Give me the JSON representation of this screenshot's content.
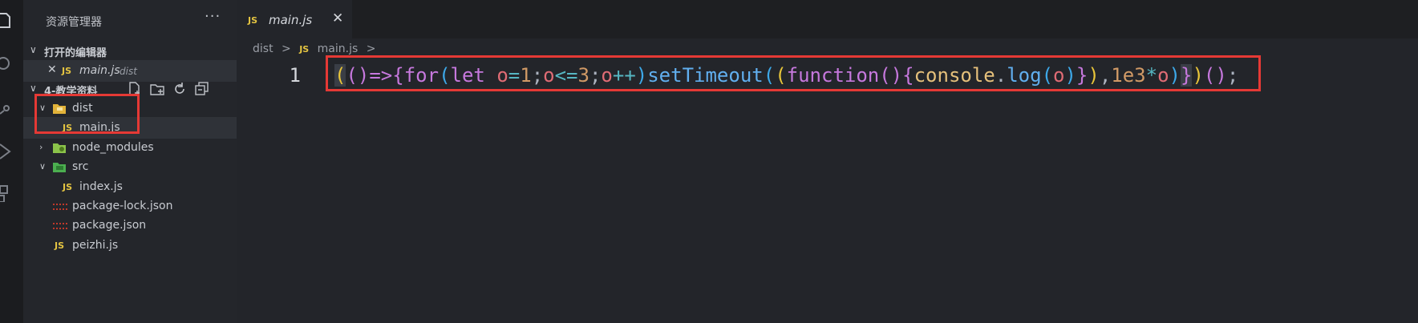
{
  "sidebar": {
    "title": "资源管理器",
    "more": "···",
    "open_editors": {
      "label": "打开的编辑器",
      "items": [
        {
          "close": "✕",
          "badge": "JS",
          "name": "main.js",
          "folder": "dist"
        }
      ]
    },
    "project": {
      "label": "4-教学资料",
      "items": [
        {
          "name": "dist",
          "type": "folder",
          "expanded": true
        },
        {
          "name": "main.js",
          "type": "js"
        },
        {
          "name": "node_modules",
          "type": "folder",
          "expanded": false
        },
        {
          "name": "src",
          "type": "folder",
          "expanded": true
        },
        {
          "name": "index.js",
          "type": "js"
        },
        {
          "name": "package-lock.json",
          "type": "json"
        },
        {
          "name": "package.json",
          "type": "json"
        },
        {
          "name": "peizhi.js",
          "type": "js"
        }
      ]
    }
  },
  "editor": {
    "tab": {
      "badge": "JS",
      "name": "main.js",
      "close": "✕"
    },
    "breadcrumb": [
      "dist",
      "main.js"
    ],
    "breadcrumb_sep": ">",
    "line_number": "1",
    "code_tokens": [
      {
        "t": "(",
        "c": "#e8c53a",
        "hl": true
      },
      {
        "t": "()",
        "c": "#c678dd"
      },
      {
        "t": "=>",
        "c": "#c678dd"
      },
      {
        "t": "{",
        "c": "#c678dd"
      },
      {
        "t": "for",
        "c": "#c678dd"
      },
      {
        "t": "(",
        "c": "#3da8e8"
      },
      {
        "t": "let",
        "c": "#c678dd"
      },
      {
        "t": " ",
        "c": "#d4d7dc"
      },
      {
        "t": "o",
        "c": "#e06c75"
      },
      {
        "t": "=",
        "c": "#56b6c2"
      },
      {
        "t": "1",
        "c": "#d19a66"
      },
      {
        "t": ";",
        "c": "#abb2bf"
      },
      {
        "t": "o",
        "c": "#e06c75"
      },
      {
        "t": "<=",
        "c": "#56b6c2"
      },
      {
        "t": "3",
        "c": "#d19a66"
      },
      {
        "t": ";",
        "c": "#abb2bf"
      },
      {
        "t": "o",
        "c": "#e06c75"
      },
      {
        "t": "++",
        "c": "#56b6c2"
      },
      {
        "t": ")",
        "c": "#3da8e8"
      },
      {
        "t": "setTimeout",
        "c": "#61afef"
      },
      {
        "t": "(",
        "c": "#3da8e8"
      },
      {
        "t": "(",
        "c": "#e8c53a"
      },
      {
        "t": "function",
        "c": "#c678dd"
      },
      {
        "t": "()",
        "c": "#c678dd"
      },
      {
        "t": "{",
        "c": "#c678dd"
      },
      {
        "t": "console",
        "c": "#e5c07b"
      },
      {
        "t": ".",
        "c": "#abb2bf"
      },
      {
        "t": "log",
        "c": "#61afef"
      },
      {
        "t": "(",
        "c": "#3da8e8"
      },
      {
        "t": "o",
        "c": "#e06c75"
      },
      {
        "t": ")",
        "c": "#3da8e8"
      },
      {
        "t": "}",
        "c": "#c678dd"
      },
      {
        "t": ")",
        "c": "#e8c53a"
      },
      {
        "t": ",",
        "c": "#abb2bf"
      },
      {
        "t": "1e3",
        "c": "#d19a66"
      },
      {
        "t": "*",
        "c": "#56b6c2"
      },
      {
        "t": "o",
        "c": "#e06c75"
      },
      {
        "t": ")",
        "c": "#3da8e8"
      },
      {
        "t": "}",
        "c": "#c678dd",
        "hl": true
      },
      {
        "t": ")",
        "c": "#e8c53a"
      },
      {
        "t": "()",
        "c": "#c678dd"
      },
      {
        "t": ";",
        "c": "#abb2bf"
      }
    ]
  },
  "colors": {
    "highlight_box": "#e53935",
    "js_badge": "#e4c441",
    "folder": "#e2b33a",
    "node_modules": "#8bc34a",
    "src_folder": "#4caf50",
    "json_icon": "#c0392b"
  }
}
